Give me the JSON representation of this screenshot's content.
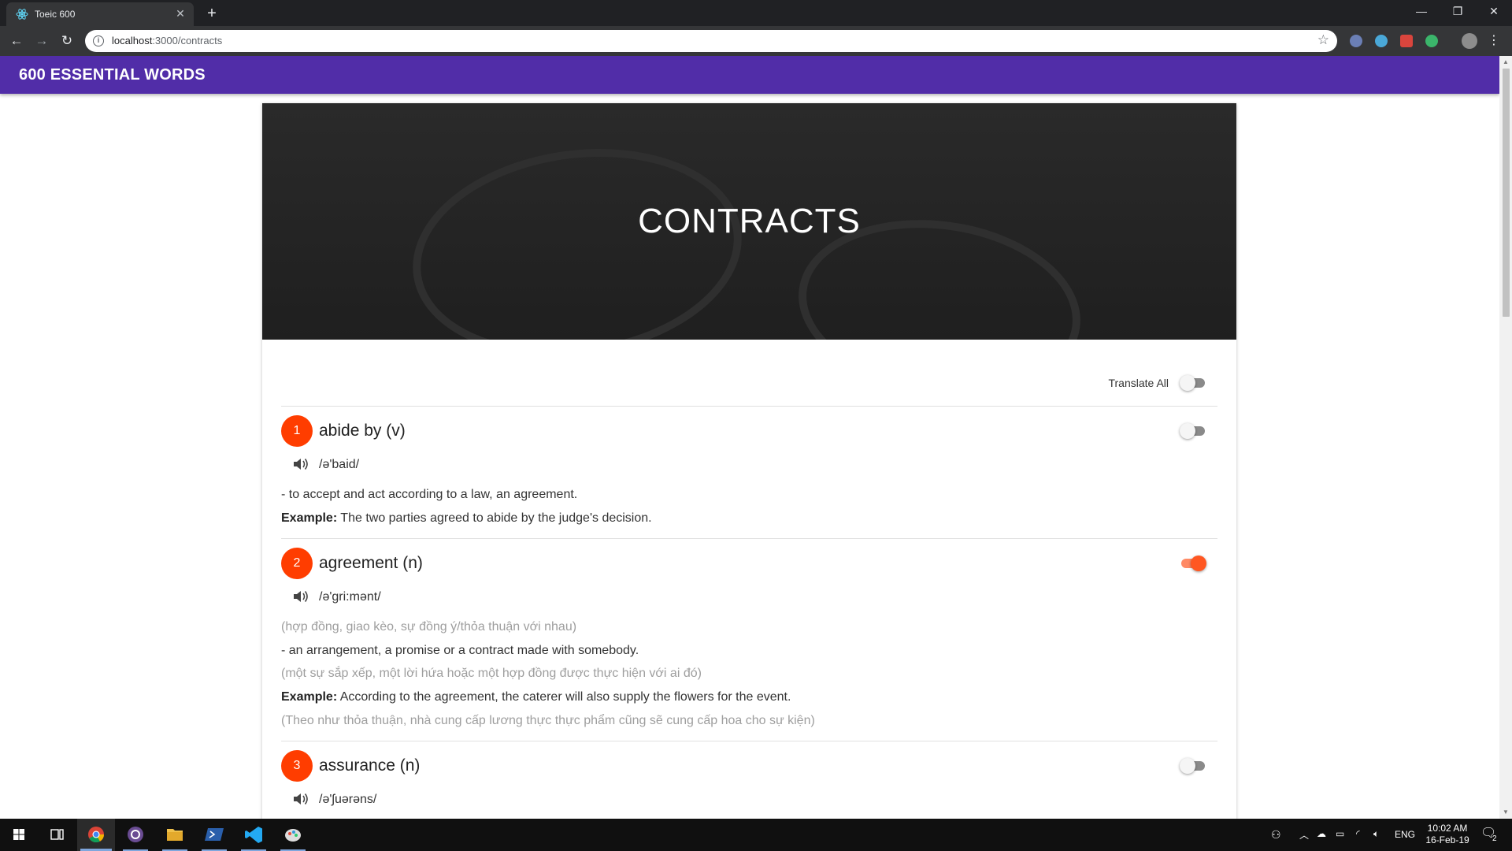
{
  "browser": {
    "tab_title": "Toeic 600",
    "new_tab": "+",
    "url_host": "localhost",
    "url_path": ":3000/contracts"
  },
  "app": {
    "brand": "600 ESSENTIAL WORDS"
  },
  "lesson": {
    "title": "CONTRACTS",
    "translate_all_label": "Translate All",
    "translate_all_on": false
  },
  "words": [
    {
      "number": "1",
      "term": "abide by (v)",
      "ipa": "/ə'baid/",
      "toggle_on": false,
      "definition": "- to accept and act according to a law, an agreement.",
      "example_label": "Example:",
      "example": " The two parties agreed to abide by the judge's decision."
    },
    {
      "number": "2",
      "term": "agreement (n)",
      "ipa": "/ə'gri:mənt/",
      "toggle_on": true,
      "translation": "(hợp đồng, giao kèo, sự đồng ý/thỏa thuận với nhau)",
      "definition": "- an arrangement, a promise or a contract made with somebody.",
      "definition_vi": "(một sự sắp xếp, một lời hứa hoặc một hợp đồng được thực hiện với ai đó)",
      "example_label": "Example:",
      "example": " According to the agreement, the caterer will also supply the flowers for the event.",
      "example_vi": "(Theo như thỏa thuận, nhà cung cấp lương thực thực phẩm cũng sẽ cung cấp hoa cho sự kiện)"
    },
    {
      "number": "3",
      "term": "assurance (n)",
      "ipa": "/ə'ʃuərəns/",
      "toggle_on": false
    }
  ],
  "taskbar": {
    "language": "ENG",
    "time": "10:02 AM",
    "date": "16-Feb-19",
    "notifications": "2"
  },
  "colors": {
    "appbar": "#512da8",
    "accent": "#ff3d00"
  }
}
